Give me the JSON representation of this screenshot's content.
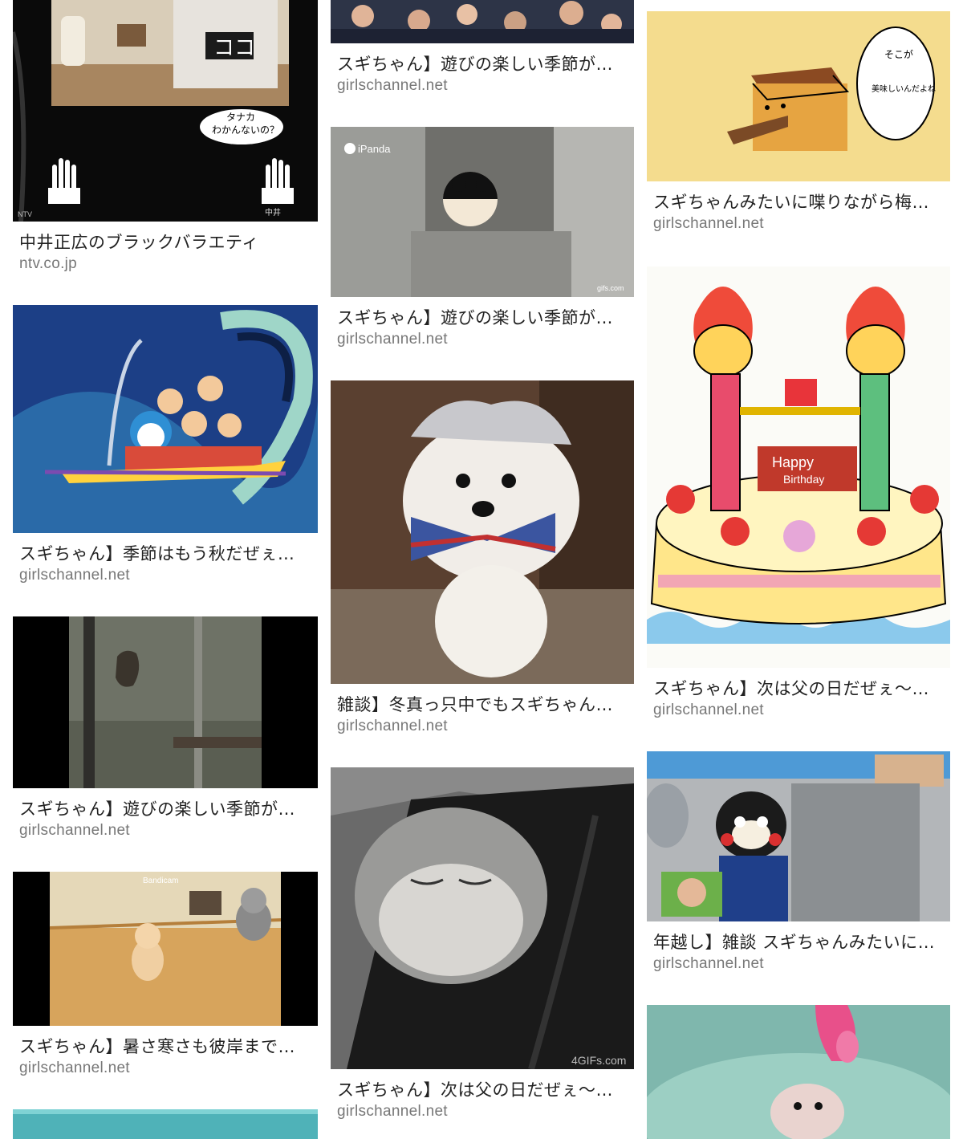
{
  "results": [
    {
      "title": "中井正広のブラックバラエティ",
      "domain": "ntv.co.jp",
      "image": "variety-show-set",
      "overlay_texts": [
        "ココ",
        "タナカ",
        "わかんないの？",
        "NTV",
        "中井"
      ]
    },
    {
      "title": "スギちゃん】季節はもう秋だぜぇ…",
      "domain": "girlschannel.net",
      "image": "anime-group-flying-carpet"
    },
    {
      "title": "スギちゃん】遊びの楽しい季節が…",
      "domain": "girlschannel.net",
      "image": "cat-climbing-screen-door"
    },
    {
      "title": "スギちゃん】暑さ寒さも彼岸まで…",
      "domain": "girlschannel.net",
      "image": "kittens-walking",
      "overlay_texts": [
        "Bandicam"
      ]
    },
    {
      "title": "",
      "domain": "",
      "image": "water-partial"
    },
    {
      "title": "スギちゃん】遊びの楽しい季節が…",
      "domain": "girlschannel.net",
      "image": "cheering-crowd"
    },
    {
      "title": "スギちゃん】遊びの楽しい季節が…",
      "domain": "girlschannel.net",
      "image": "panda-cub-in-gap",
      "overlay_texts": [
        "iPanda",
        "gifs.com"
      ]
    },
    {
      "title": "雑談】冬真っ只中でもスギちゃん…",
      "domain": "girlschannel.net",
      "image": "white-puppy-bowtie"
    },
    {
      "title": "スギちゃん】次は父の日だぜぇ～…",
      "domain": "girlschannel.net",
      "image": "sleepy-hamster",
      "overlay_texts": [
        "4GIFs.com"
      ]
    },
    {
      "title": "スギちゃんみたいに喋りながら梅…",
      "domain": "girlschannel.net",
      "image": "cartoon-bread-loaf",
      "overlay_texts": [
        "そこが",
        "美味しいんだよね"
      ]
    },
    {
      "title": "スギちゃん】次は父の日だぜぇ～…",
      "domain": "girlschannel.net",
      "image": "birthday-cake-candles",
      "overlay_texts": [
        "Happy",
        "Birthday"
      ]
    },
    {
      "title": "年越し】雑談 スギちゃんみたいに…",
      "domain": "girlschannel.net",
      "image": "kumamon-tv-show"
    },
    {
      "title": "",
      "domain": "",
      "image": "hedgehog-bath"
    }
  ]
}
